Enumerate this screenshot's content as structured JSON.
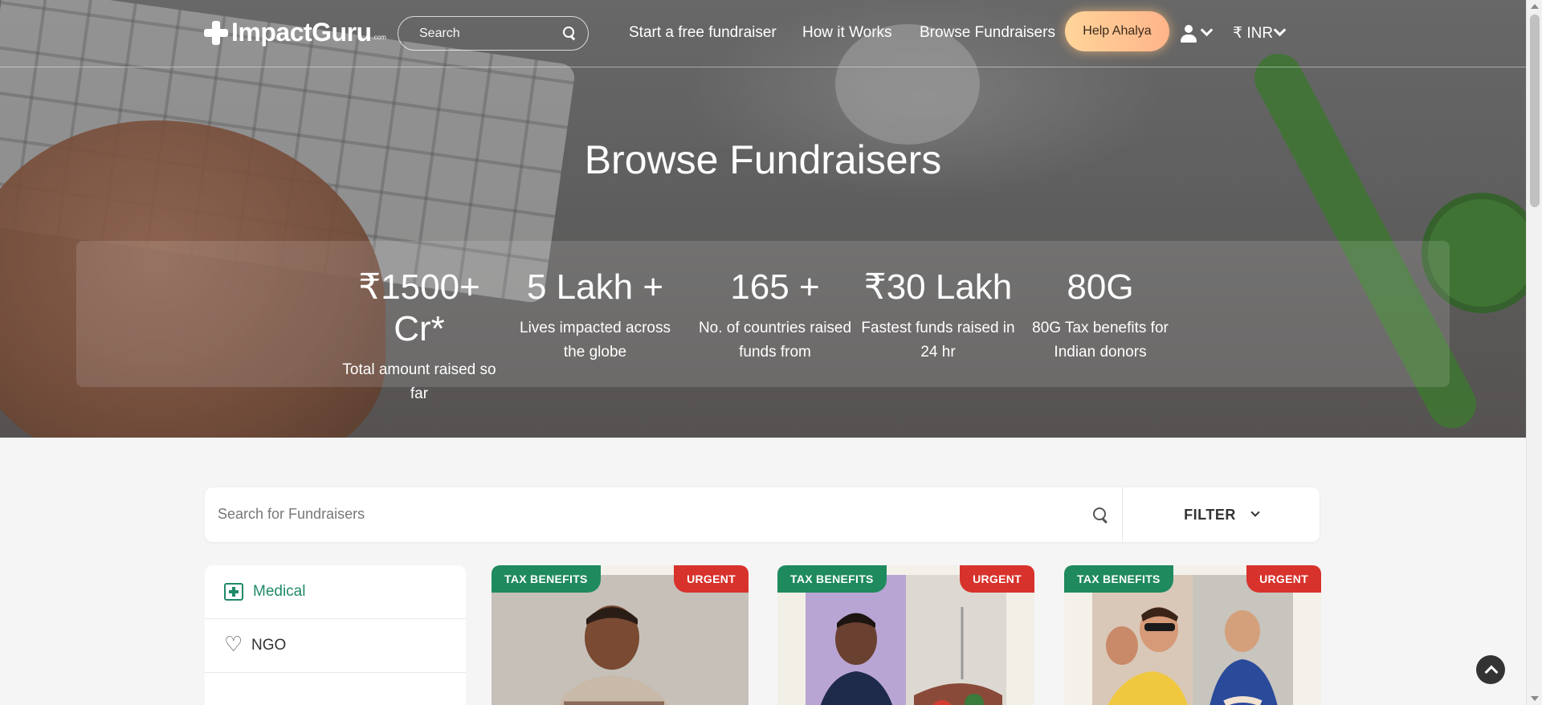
{
  "header": {
    "logo_text": "ImpactGuru",
    "logo_suffix": ".com",
    "search_placeholder": "Search",
    "nav_links": [
      "Start a free fundraiser",
      "How it Works",
      "Browse Fundraisers"
    ],
    "help_button": "Help Ahalya",
    "currency": "₹ INR"
  },
  "hero": {
    "title": "Browse Fundraisers",
    "stats": [
      {
        "value": "₹1500+ Cr*",
        "label": "Total amount raised so far"
      },
      {
        "value": "5 Lakh +",
        "label": "Lives impacted across the globe"
      },
      {
        "value": "165 +",
        "label": "No. of countries raised funds from"
      },
      {
        "value": "₹30 Lakh",
        "label": "Fastest funds raised in 24 hr"
      },
      {
        "value": "80G",
        "label": "80G Tax benefits for Indian donors"
      }
    ]
  },
  "search": {
    "placeholder": "Search for Fundraisers",
    "filter_label": "FILTER"
  },
  "categories": [
    {
      "label": "Medical",
      "icon": "medical-kit-icon",
      "active": true
    },
    {
      "label": "NGO",
      "icon": "heart-hands-icon",
      "active": false
    }
  ],
  "cards": [
    {
      "tax_badge": "TAX BENEFITS",
      "urgent_badge": "URGENT"
    },
    {
      "tax_badge": "TAX BENEFITS",
      "urgent_badge": "URGENT"
    },
    {
      "tax_badge": "TAX BENEFITS",
      "urgent_badge": "URGENT"
    }
  ],
  "colors": {
    "accent_green": "#1f8a6a",
    "tax_badge_bg": "#1f8a5e",
    "urgent_badge_bg": "#d8322c",
    "help_button_bg": "#ffc592"
  }
}
